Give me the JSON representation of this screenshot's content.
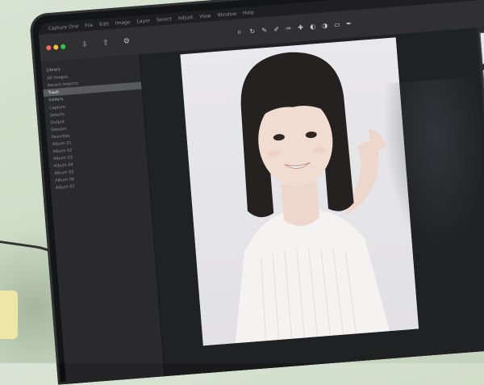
{
  "app": {
    "menubar": [
      "Capture One",
      "File",
      "Edit",
      "Image",
      "Layer",
      "Select",
      "Adjust",
      "View",
      "Window",
      "Help"
    ]
  },
  "sidebar": {
    "sections": [
      {
        "heading": "Library",
        "rows": [
          {
            "label": "All Images",
            "count": "",
            "selected": false
          },
          {
            "label": "Recent Imports",
            "count": "",
            "selected": false
          },
          {
            "label": "Trash",
            "count": "",
            "selected": true
          }
        ]
      },
      {
        "heading": "Folders",
        "rows": [
          {
            "label": "Capture",
            "count": "",
            "selected": false
          },
          {
            "label": "Selects",
            "count": "",
            "selected": false
          },
          {
            "label": "Output",
            "count": "",
            "selected": false
          },
          {
            "label": "Session",
            "count": "",
            "selected": false
          },
          {
            "label": "Favorites",
            "count": "",
            "selected": false
          },
          {
            "label": "Album 01",
            "count": "",
            "selected": false
          },
          {
            "label": "Album 02",
            "count": "",
            "selected": false
          },
          {
            "label": "Album 03",
            "count": "",
            "selected": false
          },
          {
            "label": "Album 04",
            "count": "",
            "selected": false
          },
          {
            "label": "Album 05",
            "count": "",
            "selected": false
          },
          {
            "label": "Album 06",
            "count": "",
            "selected": false
          },
          {
            "label": "Album 07",
            "count": "",
            "selected": false
          }
        ]
      }
    ]
  },
  "colors": {
    "traffic_close": "#ff5f57",
    "traffic_min": "#febc2e",
    "traffic_max": "#28c840",
    "selection": "#55555b"
  },
  "icons": [
    "import-icon",
    "export-icon",
    "settings-icon",
    "crop-icon",
    "rotate-icon",
    "brush-icon"
  ]
}
